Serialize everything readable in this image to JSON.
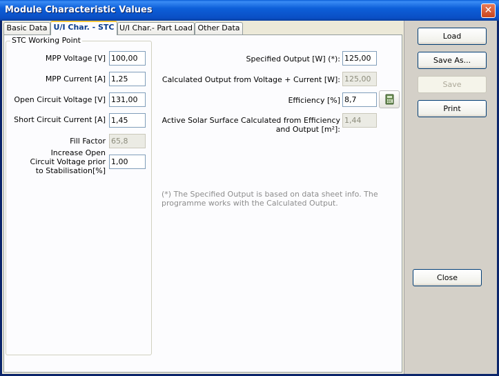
{
  "window": {
    "title": "Module Characteristic Values",
    "close_glyph": "✕"
  },
  "tabs": [
    {
      "label": "Basic Data"
    },
    {
      "label": "U/I Char. - STC"
    },
    {
      "label": "U/I Char.- Part Load"
    },
    {
      "label": "Other Data"
    }
  ],
  "stc_group": {
    "title": "STC Working Point",
    "mpp_voltage": {
      "label": "MPP Voltage [V]",
      "value": "100,00"
    },
    "mpp_current": {
      "label": "MPP Current [A]",
      "value": "1,25"
    },
    "open_circuit_voltage": {
      "label": "Open Circuit Voltage [V]",
      "value": "131,00"
    },
    "short_circuit_current": {
      "label": "Short Circuit Current [A]",
      "value": "1,45"
    },
    "fill_factor": {
      "label": "Fill Factor",
      "value": "65,8"
    },
    "increase_ocv": {
      "label": "Increase Open Circuit Voltage prior to Stabilisation[%]",
      "value": "1,00"
    }
  },
  "output": {
    "specified_output": {
      "label": "Specified Output [W] (*):",
      "value": "125,00"
    },
    "calculated_output": {
      "label": "Calculated Output from Voltage + Current [W]:",
      "value": "125,00"
    },
    "efficiency": {
      "label": "Efficiency [%]",
      "value": "8,7"
    },
    "solar_surface": {
      "label": "Active Solar Surface Calculated from Efficiency and Output [m²]:",
      "value": "1,44"
    },
    "note": "(*) The Specified Output is based on data sheet info. The programme works with the Calculated Output."
  },
  "buttons": {
    "load": "Load",
    "save_as": "Save As...",
    "save": "Save",
    "print": "Print",
    "close": "Close"
  },
  "icons": {
    "calculator": "calculator-icon"
  }
}
